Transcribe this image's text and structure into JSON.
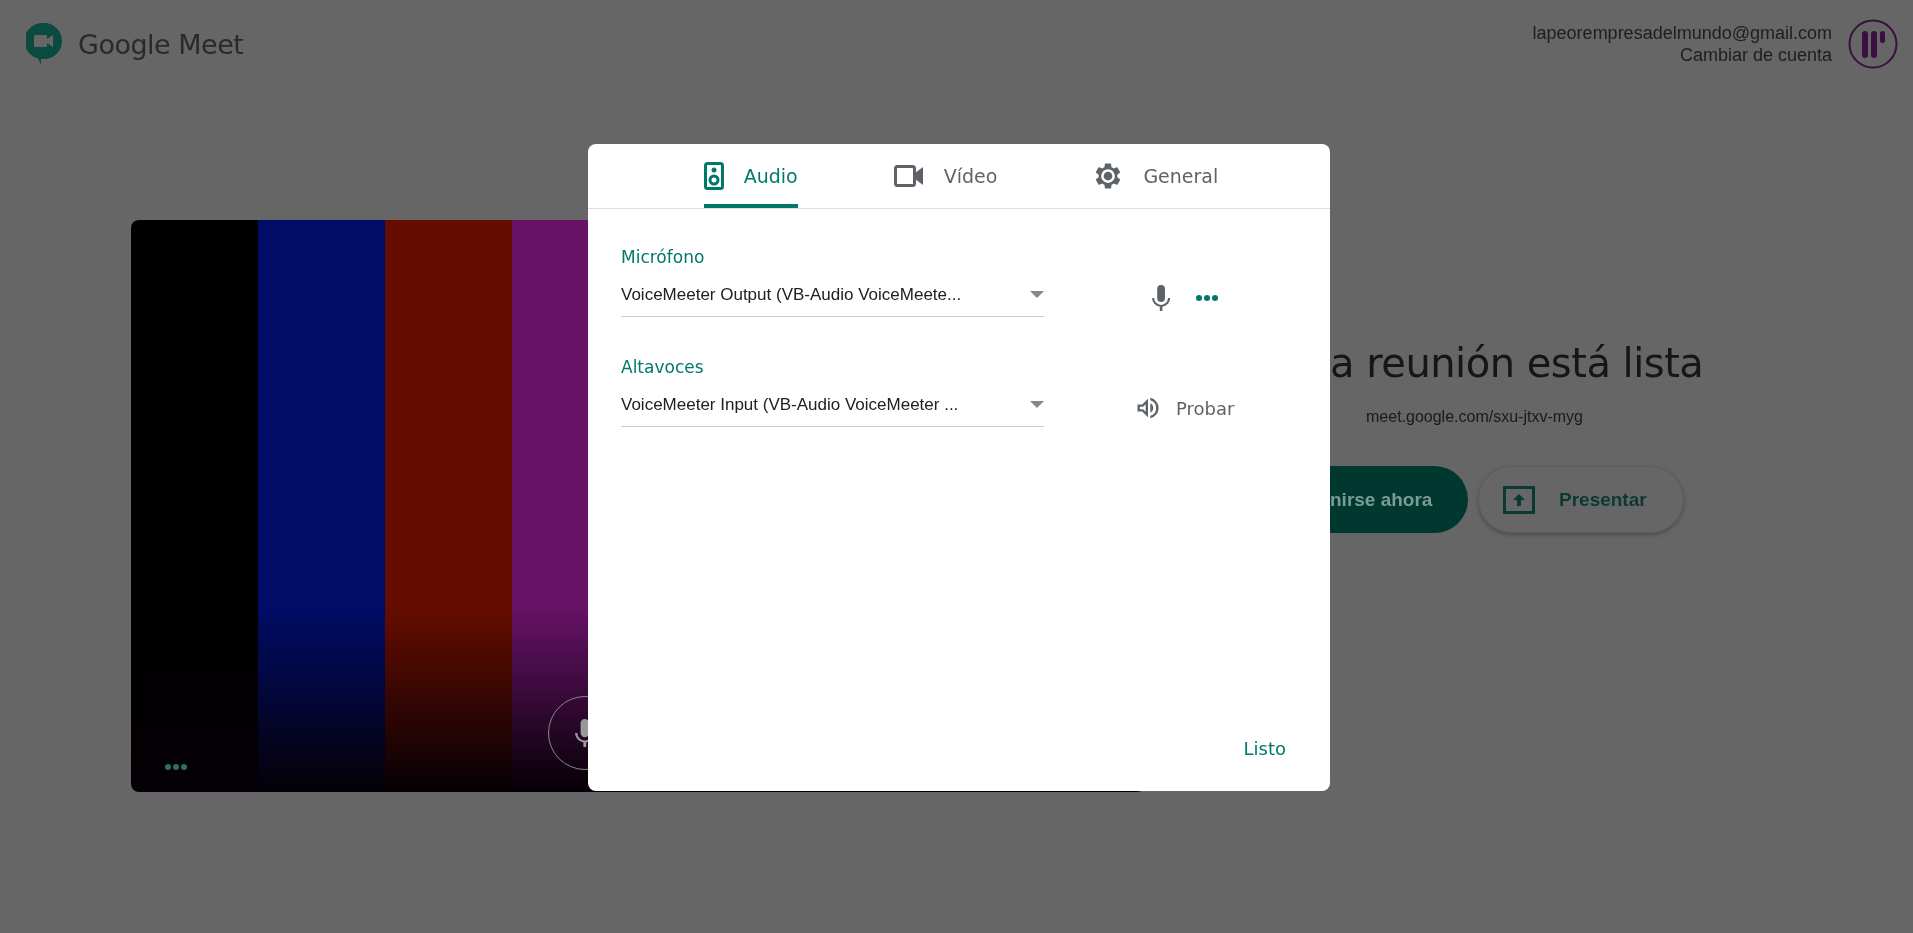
{
  "header": {
    "product": "Google Meet",
    "account_email": "lapeorempresadelmundo@gmail.com",
    "switch_account": "Cambiar de cuenta"
  },
  "preview": {
    "mic_on": true
  },
  "meeting": {
    "headline": "a reunión está lista",
    "link": "meet.google.com/sxu-jtxv-myg",
    "buttons": [
      {
        "kind": "join",
        "label": "nirse ahora"
      },
      {
        "kind": "present",
        "label": "Presentar"
      }
    ]
  },
  "dialog": {
    "tabs": [
      {
        "kind": "audio",
        "label": "Audio",
        "selected": true
      },
      {
        "kind": "video",
        "label": "Vídeo",
        "selected": false
      },
      {
        "kind": "general",
        "label": "General",
        "selected": false
      }
    ],
    "devices": [
      {
        "kind": "mic",
        "label": "Micrófono",
        "value": "VoiceMeeter Output (VB-Audio VoiceMeete..."
      },
      {
        "kind": "speaker",
        "label": "Altavoces",
        "value": "VoiceMeeter Input (VB-Audio VoiceMeeter ...",
        "action": "Probar"
      }
    ],
    "done": "Listo"
  }
}
